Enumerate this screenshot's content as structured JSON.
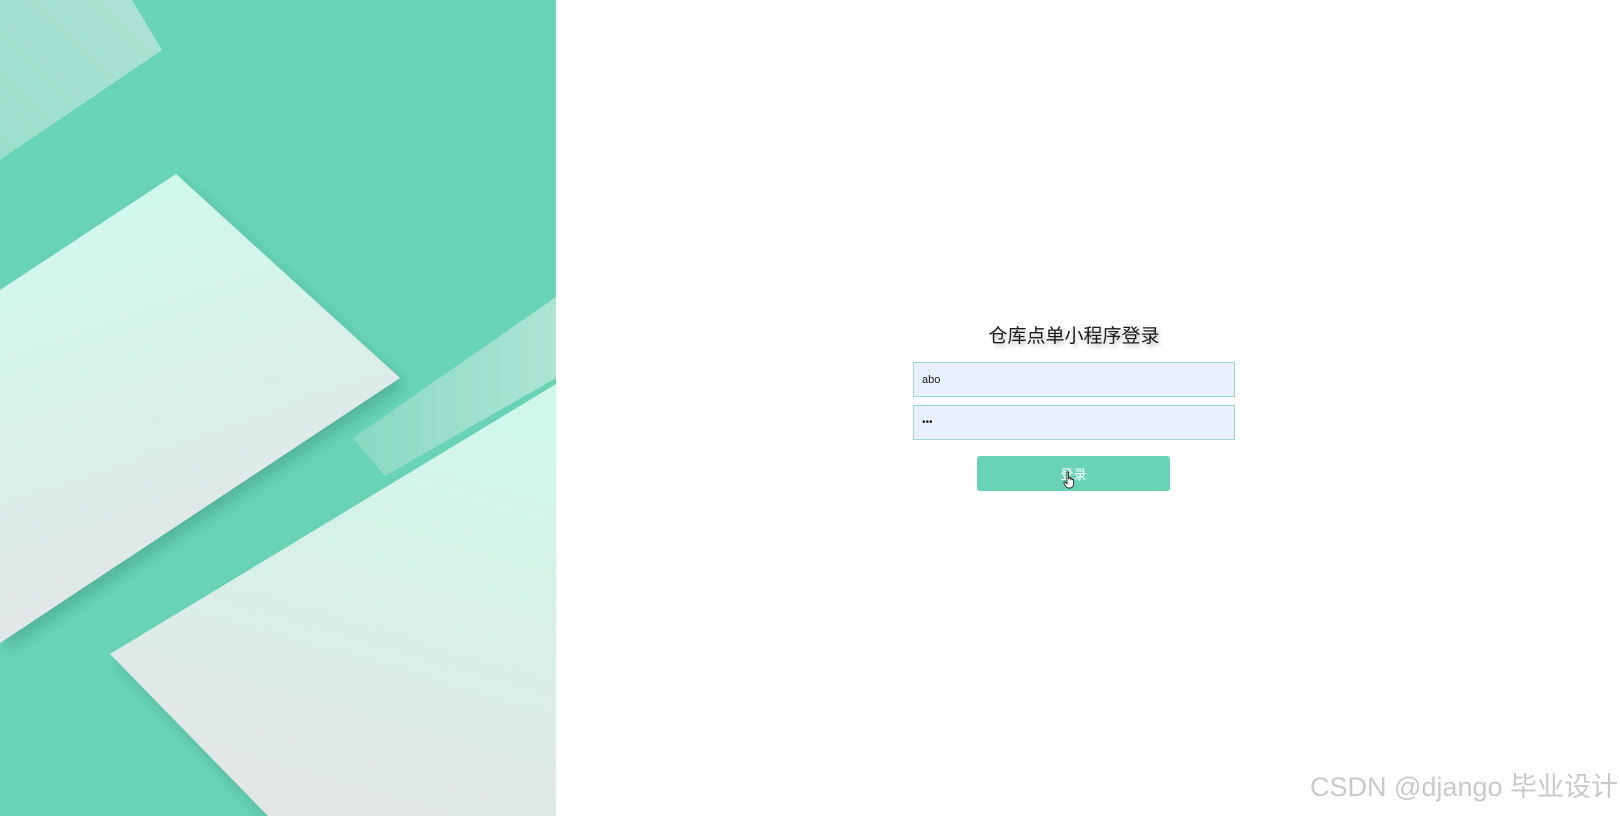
{
  "login": {
    "title": "仓库点单小程序登录",
    "username_value": "abo",
    "password_value": "•••",
    "submit_label": "登录"
  },
  "watermark": "CSDN @django 毕业设计",
  "colors": {
    "accent": "#69d4b4",
    "panel_background": "#69d4b4",
    "input_background": "#e8f0fe",
    "paper_light": "#d2f7ea",
    "paper_fade": "#e6ecea"
  },
  "icons": {
    "cursor": "hand-pointer-icon"
  }
}
